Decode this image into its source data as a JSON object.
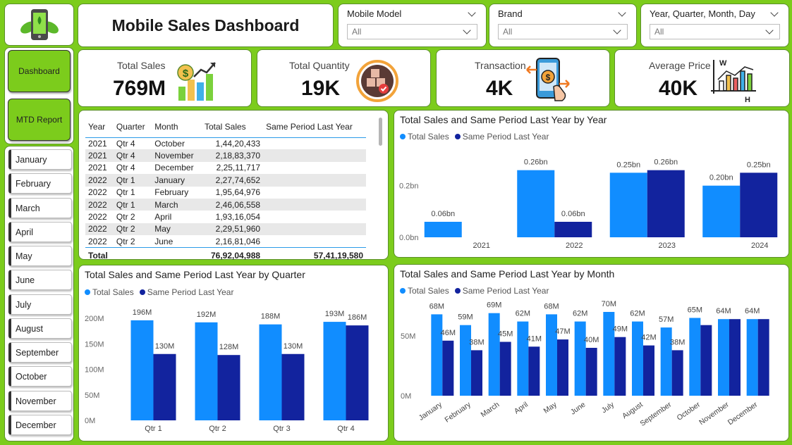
{
  "header": {
    "title": "Mobile Sales Dashboard"
  },
  "filters": [
    {
      "label": "Mobile Model",
      "value": "All"
    },
    {
      "label": "Brand",
      "value": "All"
    },
    {
      "label": "Year, Quarter, Month, Day",
      "value": "All"
    }
  ],
  "nav": {
    "dashboard": "Dashboard",
    "mtd": "MTD Report"
  },
  "months": [
    "January",
    "February",
    "March",
    "April",
    "May",
    "June",
    "July",
    "August",
    "September",
    "October",
    "November",
    "December"
  ],
  "kpis": [
    {
      "label": "Total Sales",
      "value": "769M",
      "icon": "growth-chart-icon"
    },
    {
      "label": "Total Quantity",
      "value": "19K",
      "icon": "box-check-icon"
    },
    {
      "label": "Transaction",
      "value": "4K",
      "icon": "mobile-payment-icon"
    },
    {
      "label": "Average Price",
      "value": "40K",
      "icon": "bar-chart-axes-icon"
    }
  ],
  "colors": {
    "background": "#7ccc1c",
    "total_sales": "#118dff",
    "same_period": "#12239e"
  },
  "table": {
    "headers": [
      "Year",
      "Quarter",
      "Month",
      "Total Sales",
      "Same Period Last Year"
    ],
    "rows": [
      [
        "2021",
        "Qtr 4",
        "October",
        "1,44,20,433",
        ""
      ],
      [
        "2021",
        "Qtr 4",
        "November",
        "2,18,83,370",
        ""
      ],
      [
        "2021",
        "Qtr 4",
        "December",
        "2,25,11,717",
        ""
      ],
      [
        "2022",
        "Qtr 1",
        "January",
        "2,27,74,652",
        ""
      ],
      [
        "2022",
        "Qtr 1",
        "February",
        "1,95,64,976",
        ""
      ],
      [
        "2022",
        "Qtr 1",
        "March",
        "2,46,06,558",
        ""
      ],
      [
        "2022",
        "Qtr 2",
        "April",
        "1,93,16,054",
        ""
      ],
      [
        "2022",
        "Qtr 2",
        "May",
        "2,29,51,960",
        ""
      ],
      [
        "2022",
        "Qtr 2",
        "June",
        "2,16,81,046",
        ""
      ]
    ],
    "total": [
      "Total",
      "",
      "",
      "76,92,04,988",
      "57,41,19,580"
    ]
  },
  "chart_data": [
    {
      "type": "bar",
      "title": "Total Sales and Same Period Last Year by Year",
      "categories": [
        "2021",
        "2022",
        "2023",
        "2024"
      ],
      "series": [
        {
          "name": "Total Sales",
          "values": [
            0.06,
            0.26,
            0.25,
            0.2
          ],
          "labels": [
            "0.06bn",
            "0.26bn",
            "0.25bn",
            "0.20bn"
          ]
        },
        {
          "name": "Same Period Last Year",
          "values": [
            null,
            0.06,
            0.26,
            0.25
          ],
          "labels": [
            "",
            "0.06bn",
            "0.26bn",
            "0.25bn"
          ]
        }
      ],
      "yticks": [
        "0.0bn",
        "0.2bn"
      ],
      "ylim": [
        0,
        0.3
      ]
    },
    {
      "type": "bar",
      "title": "Total Sales and Same Period Last Year by Quarter",
      "categories": [
        "Qtr 1",
        "Qtr 2",
        "Qtr 3",
        "Qtr 4"
      ],
      "series": [
        {
          "name": "Total Sales",
          "values": [
            196,
            192,
            188,
            193
          ],
          "labels": [
            "196M",
            "192M",
            "188M",
            "193M"
          ]
        },
        {
          "name": "Same Period Last Year",
          "values": [
            130,
            128,
            130,
            186
          ],
          "labels": [
            "130M",
            "128M",
            "130M",
            "186M"
          ]
        }
      ],
      "yticks": [
        "0M",
        "50M",
        "100M",
        "150M",
        "200M"
      ],
      "ylim": [
        0,
        200
      ]
    },
    {
      "type": "bar",
      "title": "Total Sales and Same Period Last Year by Month",
      "categories": [
        "January",
        "February",
        "March",
        "April",
        "May",
        "June",
        "July",
        "August",
        "September",
        "October",
        "November",
        "December"
      ],
      "series": [
        {
          "name": "Total Sales",
          "values": [
            68,
            59,
            69,
            62,
            68,
            62,
            70,
            62,
            57,
            65,
            64,
            64
          ],
          "labels": [
            "68M",
            "59M",
            "69M",
            "62M",
            "68M",
            "62M",
            "70M",
            "62M",
            "57M",
            "65M",
            "64M",
            "64M"
          ]
        },
        {
          "name": "Same Period Last Year",
          "values": [
            46,
            38,
            45,
            41,
            47,
            40,
            49,
            42,
            38,
            59,
            64,
            64
          ],
          "labels": [
            "46M",
            "38M",
            "45M",
            "41M",
            "47M",
            "40M",
            "49M",
            "42M",
            "38M",
            "",
            "",
            ""
          ]
        }
      ],
      "yticks": [
        "0M",
        "50M"
      ],
      "ylim": [
        0,
        80
      ]
    }
  ]
}
